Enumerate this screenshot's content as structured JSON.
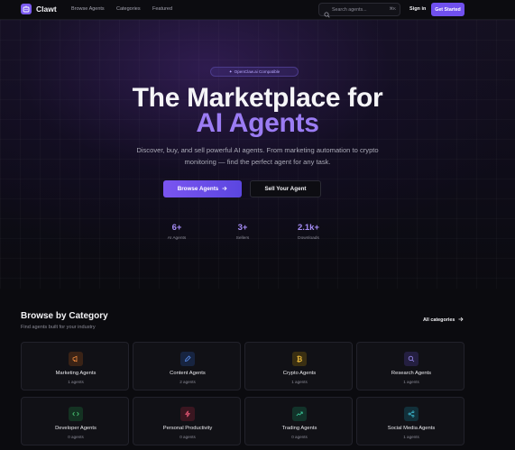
{
  "nav": {
    "brand": "Clawt",
    "links": [
      "Browse Agents",
      "Categories",
      "Featured"
    ],
    "search_placeholder": "Search agents...",
    "search_shortcut": "⌘K",
    "signin": "Sign in",
    "get_started": "Get Started"
  },
  "hero": {
    "badge": "OpenClaw.ai Compatible",
    "title_line1": "The Marketplace for",
    "title_line2": "AI Agents",
    "subtitle": "Discover, buy, and sell powerful AI agents. From marketing automation to crypto monitoring — find the perfect agent for any task.",
    "primary_button": "Browse Agents",
    "secondary_button": "Sell Your Agent",
    "stats": [
      {
        "value": "6+",
        "label": "AI Agents"
      },
      {
        "value": "3+",
        "label": "Sellers"
      },
      {
        "value": "2.1k+",
        "label": "Downloads"
      }
    ]
  },
  "categories": {
    "title": "Browse by Category",
    "subtitle": "Find agents built for your industry",
    "all_link": "All categories",
    "items": [
      {
        "name": "Marketing Agents",
        "count": "1 agents",
        "icon": "megaphone-icon",
        "color": "#f08a3c",
        "bg": "#3a2316"
      },
      {
        "name": "Content Agents",
        "count": "2 agents",
        "icon": "pen-icon",
        "color": "#5b8ff0",
        "bg": "#172440"
      },
      {
        "name": "Crypto Agents",
        "count": "1 agents",
        "icon": "bitcoin-icon",
        "color": "#e8b73a",
        "bg": "#3a2f12"
      },
      {
        "name": "Research Agents",
        "count": "1 agents",
        "icon": "search-icon",
        "color": "#9c8cf2",
        "bg": "#241f40"
      },
      {
        "name": "Developer Agents",
        "count": "0 agents",
        "icon": "code-icon",
        "color": "#4fd07a",
        "bg": "#143222"
      },
      {
        "name": "Personal Productivity",
        "count": "0 agents",
        "icon": "bolt-icon",
        "color": "#f05a7a",
        "bg": "#3a1620"
      },
      {
        "name": "Trading Agents",
        "count": "0 agents",
        "icon": "trend-up-icon",
        "color": "#3fd0a0",
        "bg": "#12332a"
      },
      {
        "name": "Social Media Agents",
        "count": "1 agents",
        "icon": "share-icon",
        "color": "#3fc0d8",
        "bg": "#12303a"
      }
    ]
  }
}
